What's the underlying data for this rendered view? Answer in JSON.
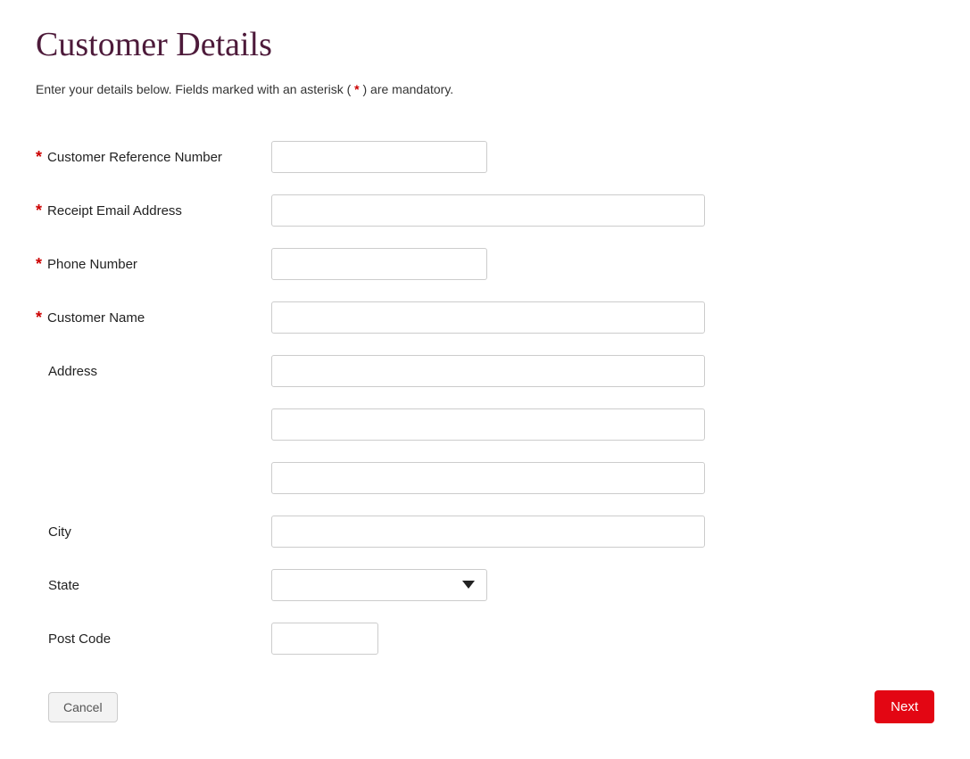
{
  "title": "Customer Details",
  "intro": {
    "before": "Enter your details below. Fields marked with an asterisk (",
    "asterisk": "*",
    "after": ") are mandatory."
  },
  "fields": {
    "customer_ref": {
      "label": "Customer Reference Number",
      "required": true,
      "value": ""
    },
    "email": {
      "label": "Receipt Email Address",
      "required": true,
      "value": ""
    },
    "phone": {
      "label": "Phone Number",
      "required": true,
      "value": ""
    },
    "name": {
      "label": "Customer Name",
      "required": true,
      "value": ""
    },
    "address1": {
      "label": "Address",
      "required": false,
      "value": ""
    },
    "address2": {
      "label": "",
      "required": false,
      "value": ""
    },
    "address3": {
      "label": "",
      "required": false,
      "value": ""
    },
    "city": {
      "label": "City",
      "required": false,
      "value": ""
    },
    "state": {
      "label": "State",
      "required": false,
      "value": ""
    },
    "postcode": {
      "label": "Post Code",
      "required": false,
      "value": ""
    }
  },
  "buttons": {
    "cancel": "Cancel",
    "next": "Next"
  }
}
